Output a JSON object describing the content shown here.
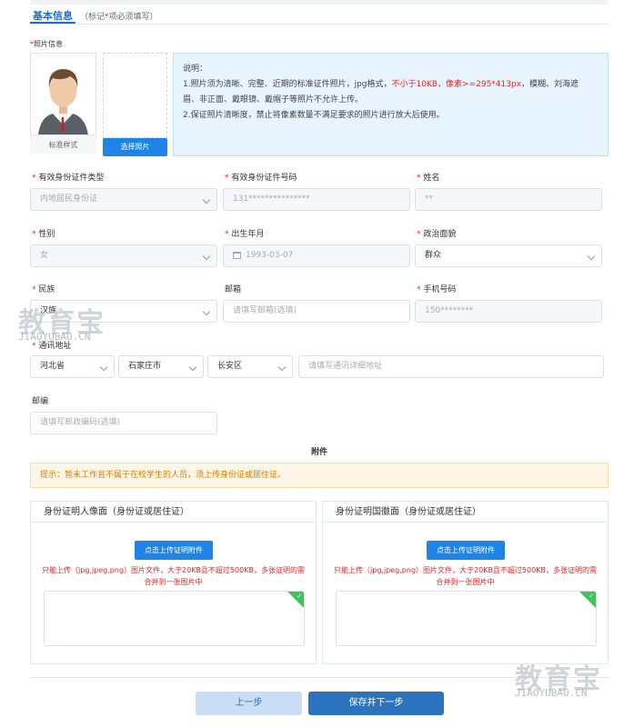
{
  "tab": {
    "label": "基本信息",
    "note_prefix": "（标记",
    "note_star": "*",
    "note_suffix": "项必须填写）"
  },
  "photo": {
    "label": "*照片信息",
    "caption": "标准样式",
    "select_button": "选择照片"
  },
  "info": {
    "title": "说明：",
    "line1_a": "1.照片须为清晰、完整、近期的标准证件照片，jpg格式，",
    "line1_red": "不小于10KB，像素>=295*413px",
    "line1_b": "，模糊、刘海遮",
    "line2": "眉、非正面、戴眼镜、戴帽子等照片不允许上传。",
    "line3": "2.保证照片清晰度，禁止将像素数量不满足要求的照片进行放大后使用。"
  },
  "fields": {
    "id_type": {
      "label": "有效身份证件类型",
      "value": "内地居民身份证"
    },
    "id_number": {
      "label": "有效身份证件号码",
      "value": "131***************"
    },
    "name": {
      "label": "姓名",
      "value": "**"
    },
    "gender": {
      "label": "性别",
      "value": "女"
    },
    "birth": {
      "label": "出生年月",
      "value": "1993-03-07"
    },
    "politics": {
      "label": "政治面貌",
      "value": "群众"
    },
    "ethnic": {
      "label": "民族",
      "value": "汉族"
    },
    "email": {
      "label": "邮箱",
      "placeholder": "请填写邮箱(选填)"
    },
    "phone": {
      "label": "手机号码",
      "value": "150********"
    },
    "address": {
      "label": "通讯地址",
      "province": "河北省",
      "city": "石家庄市",
      "district": "长安区",
      "detail_placeholder": "请填写通讯详细地址"
    },
    "postcode": {
      "label": "邮编",
      "placeholder": "请填写邮政编码(选填)"
    }
  },
  "attachment": {
    "title": "附件",
    "warning": "提示：暂未工作且不属于在校学生的人员，须上传身份证或居住证。",
    "front": {
      "title": "身份证明人像面（身份证或居住证）",
      "button": "点击上传证明附件",
      "note1": "只能上传（jpg,jpeg,png）图片文件，大于20KB且不超过500KB，多张证明的需",
      "note2": "合并到一张图片中"
    },
    "back": {
      "title": "身份证明国徽面（身份证或居住证）",
      "button": "点击上传证明附件",
      "note1": "只能上传（jpg,jpeg,png）图片文件，大于20KB且不超过500KB，多张证明的需",
      "note2": "合并到一张图片中"
    }
  },
  "footer": {
    "prev": "上一步",
    "next": "保存并下一步"
  },
  "watermark": {
    "main": "教育宝",
    "sub": "JIAOYUBAO.CN"
  }
}
